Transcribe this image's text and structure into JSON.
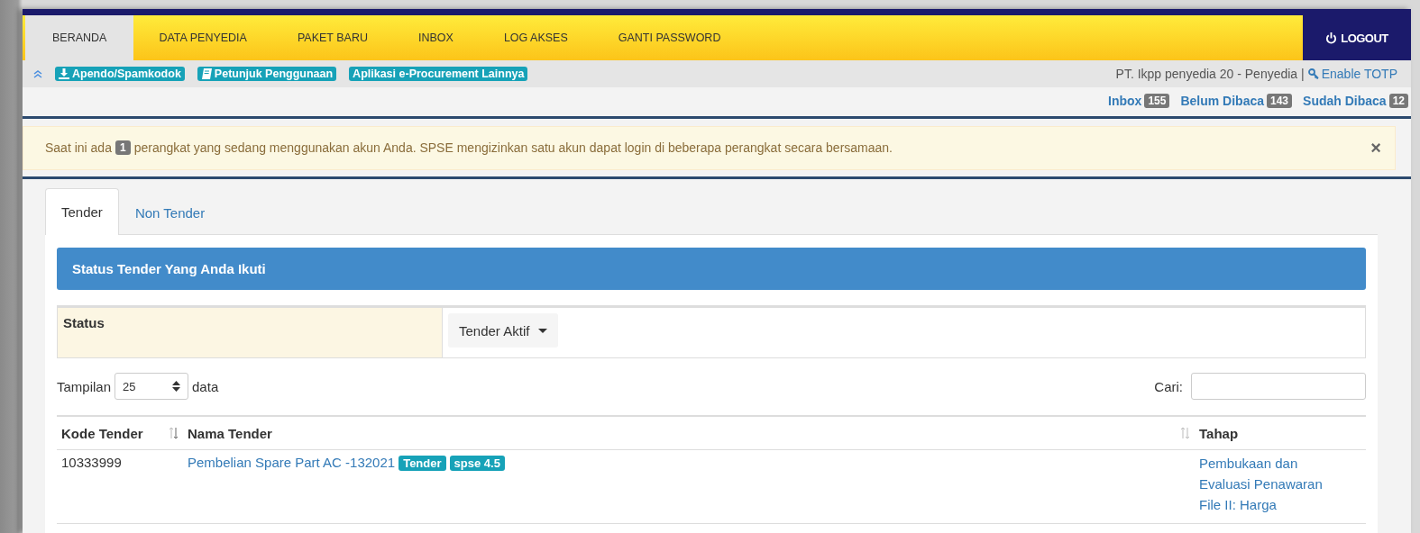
{
  "nav": {
    "items": [
      {
        "label": "BERANDA",
        "selected": true
      },
      {
        "label": "DATA PENYEDIA",
        "selected": false
      },
      {
        "label": "PAKET BARU",
        "selected": false
      },
      {
        "label": "INBOX",
        "selected": false
      },
      {
        "label": "LOG AKSES",
        "selected": false
      },
      {
        "label": "GANTI PASSWORD",
        "selected": false
      }
    ],
    "logout": "LOGOUT"
  },
  "toolbar": {
    "links": [
      {
        "label": "Apendo/Spamkodok"
      },
      {
        "label": "Petunjuk Penggunaan"
      },
      {
        "label": "Aplikasi e-Procurement Lainnya"
      }
    ],
    "user": "PT. Ikpp penyedia 20 - Penyedia |",
    "totp": "Enable TOTP"
  },
  "messages": [
    {
      "label": "Inbox",
      "count": "155"
    },
    {
      "label": "Belum Dibaca",
      "count": "143"
    },
    {
      "label": "Sudah Dibaca",
      "count": "12"
    }
  ],
  "alert": {
    "before": "Saat ini ada",
    "count": "1",
    "after": "perangkat yang sedang menggunakan akun Anda. SPSE mengizinkan satu akun dapat login di beberapa perangkat secara bersamaan.",
    "close": "×"
  },
  "tabs": [
    {
      "label": "Tender",
      "selected": true
    },
    {
      "label": "Non Tender",
      "selected": false
    }
  ],
  "panel": {
    "title": "Status Tender Yang Anda Ikuti",
    "filter": {
      "label": "Status",
      "value": "Tender Aktif"
    },
    "length": {
      "before": "Tampilan",
      "value": "25",
      "after": "data"
    },
    "search": {
      "label": "Cari:"
    },
    "table": {
      "columns": [
        {
          "label": "Kode Tender",
          "sortable": true
        },
        {
          "label": "Nama Tender",
          "sortable": true
        },
        {
          "label": "Tahap",
          "sortable": false
        }
      ],
      "rows": [
        {
          "kode": "10333999",
          "nama": "Pembelian Spare Part AC -132021",
          "badges": [
            "Tender",
            "spse 4.5"
          ],
          "tahap": "Pembukaan dan Evaluasi Penawaran File II: Harga"
        }
      ]
    }
  }
}
